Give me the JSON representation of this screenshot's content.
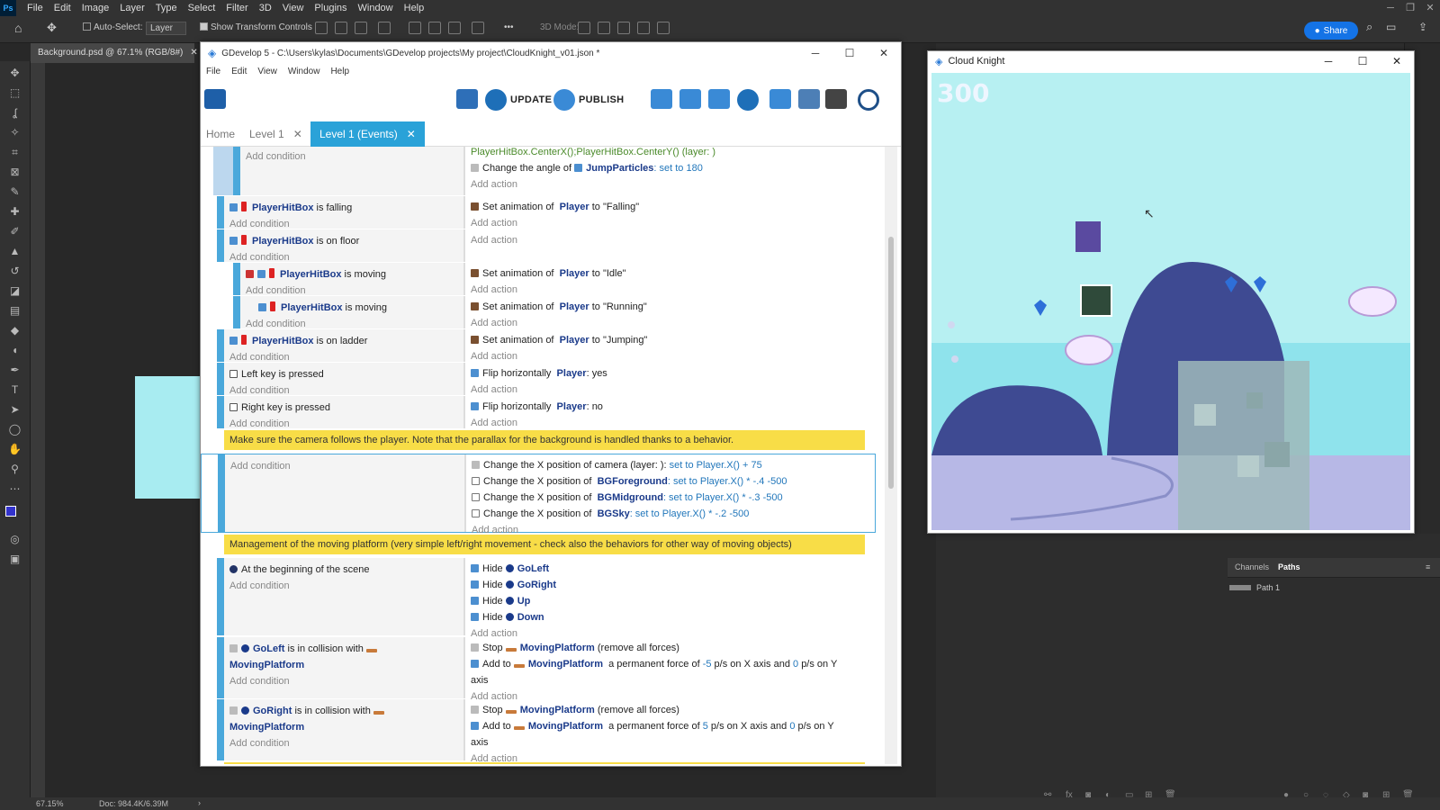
{
  "photoshop": {
    "menu": [
      "File",
      "Edit",
      "Image",
      "Layer",
      "Type",
      "Select",
      "Filter",
      "3D",
      "View",
      "Plugins",
      "Window",
      "Help"
    ],
    "options": {
      "auto_select": "Auto-Select:",
      "layer_select": "Layer",
      "show_transform": "Show Transform Controls",
      "mode_3d": "3D Mode:",
      "share": "Share"
    },
    "doc_tab": "Background.psd @ 67.1% (RGB/8#)",
    "status": {
      "zoom": "67.15%",
      "doc": "Doc: 984.4K/6.39M"
    },
    "panels": {
      "channels": "Channels",
      "paths": "Paths",
      "path1": "Path 1"
    }
  },
  "gdevelop": {
    "title": "GDevelop 5 - C:\\Users\\kylas\\Documents\\GDevelop projects\\My project\\CloudKnight_v01.json *",
    "menu": [
      "File",
      "Edit",
      "View",
      "Window",
      "Help"
    ],
    "toolbar": {
      "update": "UPDATE",
      "publish": "PUBLISH"
    },
    "tabs": [
      {
        "label": "Home"
      },
      {
        "label": "Level 1"
      },
      {
        "label": "Level 1 (Events)"
      }
    ],
    "add_condition": "Add condition",
    "add_action": "Add action",
    "events": {
      "e0": {
        "a1": "PlayerHitBox.CenterX();PlayerHitBox.CenterY() (layer: )",
        "a2_pre": "Change the angle of",
        "a2_obj": "JumpParticles",
        "a2_set": ": set to",
        "a2_val": "180"
      },
      "e1": {
        "obj": "PlayerHitBox",
        "cond": "is falling",
        "a_pre": "Set animation of",
        "a_obj": "Player",
        "a_post": "to \"Falling\""
      },
      "e2": {
        "obj": "PlayerHitBox",
        "cond": "is on floor"
      },
      "e3": {
        "obj": "PlayerHitBox",
        "cond": "is moving",
        "a_pre": "Set animation of",
        "a_obj": "Player",
        "a_post": "to \"Idle\""
      },
      "e4": {
        "obj": "PlayerHitBox",
        "cond": "is moving",
        "a_pre": "Set animation of",
        "a_obj": "Player",
        "a_post": "to \"Running\""
      },
      "e5": {
        "obj": "PlayerHitBox",
        "cond": "is on ladder",
        "a_pre": "Set animation of",
        "a_obj": "Player",
        "a_post": "to \"Jumping\""
      },
      "e6": {
        "cond": "Left key is pressed",
        "a_pre": "Flip horizontally",
        "a_obj": "Player",
        "a_post": ": yes"
      },
      "e7": {
        "cond": "Right key is pressed",
        "a_pre": "Flip horizontally",
        "a_obj": "Player",
        "a_post": ": no"
      },
      "c1": "Make sure the camera follows the player. Note that the parallax for the background is handled thanks to a behavior.",
      "e8": {
        "a1_pre": "Change the X position of camera (layer: ):",
        "a1_val": "set to  Player.X() + 75",
        "a2_pre": "Change the X position of",
        "a2_obj": "BGForeground",
        "a2_val": ": set to  Player.X() * -.4 -500",
        "a3_pre": "Change the X position of",
        "a3_obj": "BGMidground",
        "a3_val": ": set to  Player.X() * -.3 -500",
        "a4_pre": "Change the X position of",
        "a4_obj": "BGSky",
        "a4_val": ": set to  Player.X() * -.2 -500"
      },
      "c2": "Management of the moving platform (very simple left/right movement - check also the behaviors for other way of moving objects)",
      "e9": {
        "cond": "At the beginning of the scene",
        "hide": "Hide",
        "h1": "GoLeft",
        "h2": "GoRight",
        "h3": "Up",
        "h4": "Down"
      },
      "e10": {
        "obj": "GoLeft",
        "cond": "is in collision with",
        "obj2": "MovingPlatform",
        "stop": "Stop",
        "stop_obj": "MovingPlatform",
        "stop_post": "(remove all forces)",
        "add_pre": "Add to",
        "add_obj": "MovingPlatform",
        "add_post1": "a permanent force of",
        "add_v1": "-5",
        "add_post2": "p/s on X axis and",
        "add_v2": "0",
        "add_post3": "p/s on Y",
        "add_wrap": "axis"
      },
      "e11": {
        "obj": "GoRight",
        "cond": "is in collision with",
        "obj2": "MovingPlatform",
        "stop": "Stop",
        "stop_obj": "MovingPlatform",
        "stop_post": "(remove all forces)",
        "add_pre": "Add to",
        "add_obj": "MovingPlatform",
        "add_post1": "a permanent force of",
        "add_v1": "5",
        "add_post2": "p/s on X axis and",
        "add_v2": "0",
        "add_post3": "p/s on Y",
        "add_wrap": "axis"
      }
    }
  },
  "game": {
    "title": "Cloud Knight",
    "score": "300"
  }
}
